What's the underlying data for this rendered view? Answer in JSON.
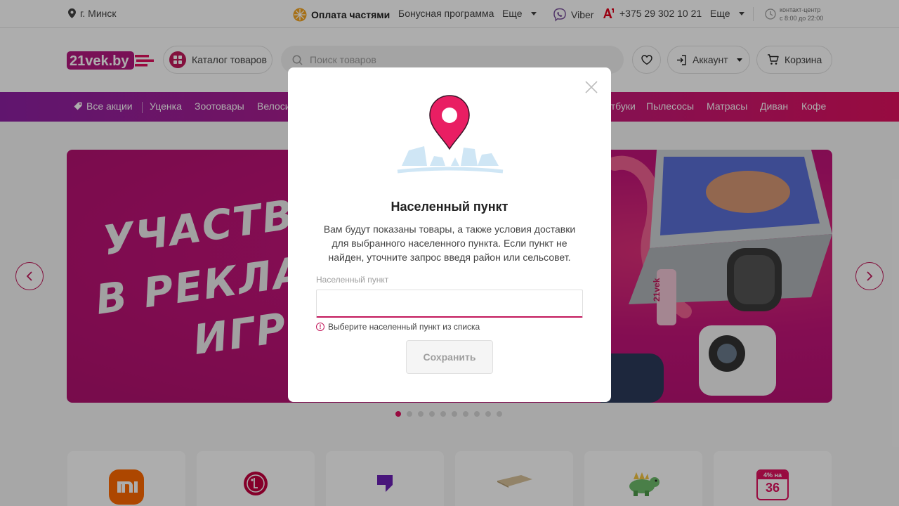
{
  "topbar": {
    "city": "г. Минск",
    "installments": "Оплата частями",
    "bonus": "Бонусная программа",
    "more1": "Еще",
    "viber": "Viber",
    "phone": "+375 29 302 10 21",
    "more2": "Еще",
    "contact_title": "контакт-центр",
    "contact_hours": "с 8:00 до 22:00"
  },
  "header": {
    "logo": "21vek.by",
    "catalog": "Каталог товаров",
    "search_placeholder": "Поиск товаров",
    "account": "Аккаунт",
    "cart": "Корзина"
  },
  "nav": {
    "items": [
      "Все акции",
      "Уценка",
      "Зоотовары",
      "Велосипеды",
      "Ноутбуки",
      "Пылесосы",
      "Матрасы",
      "Диван",
      "Кофе"
    ]
  },
  "banner": {
    "line1": "УЧАСТВУЙ",
    "line2": "В РЕКЛАМ",
    "line3": "ИГРЕ",
    "brand": "21vek",
    "dots_total": 10,
    "dots_active_index": 0
  },
  "brands": [
    "mi-logo",
    "lg-logo",
    "brand-logo",
    "mat-product",
    "toy-dino",
    "installment-badge"
  ],
  "brand_badge": {
    "top": "4% на",
    "bottom": "36"
  },
  "modal": {
    "title": "Населенный пункт",
    "description": "Вам будут показаны товары, а также условия доставки для выбранного населенного пункта. Если пункт не найден, уточните запрос введя район или сельсовет.",
    "field_label": "Населенный пункт",
    "field_value": "",
    "error_text": "Выберите населенный пункт из списка",
    "save": "Сохранить"
  },
  "colors": {
    "accent": "#c2185b",
    "nav_start": "#8e1fa3",
    "nav_end": "#e0115f",
    "banner": "#c3147a"
  }
}
